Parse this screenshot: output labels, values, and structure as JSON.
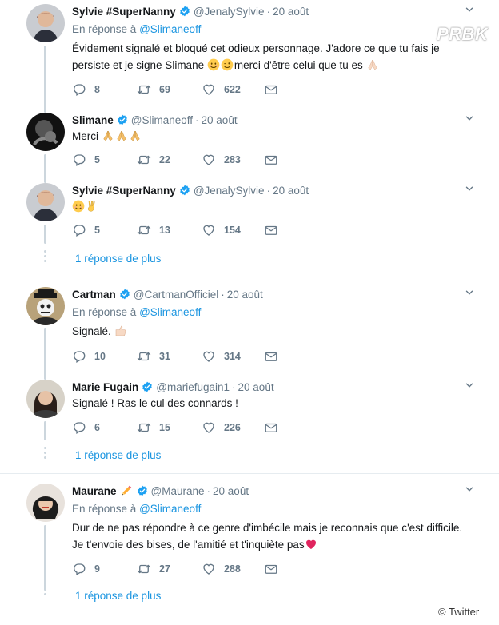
{
  "watermark": "PRBK",
  "credit": "© Twitter",
  "more_replies_label": "1 réponse de plus",
  "tweets": [
    {
      "name": "Sylvie #SuperNanny",
      "handle": "@JenalySylvie",
      "time": "20 août",
      "reply_prefix": "En réponse à",
      "reply_to": "@Slimaneoff",
      "text_line1": "Évidement signalé et bloqué cet odieux personnage. J'adore ce que  tu fais je",
      "text_line2": "persiste et je signe Slimane",
      "text_line2_end": "merci d'être celui que tu es",
      "replies": "8",
      "retweets": "69",
      "likes": "622"
    },
    {
      "name": "Slimane",
      "handle": "@Slimaneoff",
      "time": "20 août",
      "text": "Merci",
      "replies": "5",
      "retweets": "22",
      "likes": "283"
    },
    {
      "name": "Sylvie #SuperNanny",
      "handle": "@JenalySylvie",
      "time": "20 août",
      "replies": "5",
      "retweets": "13",
      "likes": "154"
    },
    {
      "name": "Cartman",
      "handle": "@CartmanOfficiel",
      "time": "20 août",
      "reply_prefix": "En réponse à",
      "reply_to": "@Slimaneoff",
      "text": "Signalé.",
      "replies": "10",
      "retweets": "31",
      "likes": "314"
    },
    {
      "name": "Marie Fugain",
      "handle": "@mariefugain1",
      "time": "20 août",
      "text": "Signalé ! Ras le cul des connards !",
      "replies": "6",
      "retweets": "15",
      "likes": "226"
    },
    {
      "name": "Maurane",
      "handle": "@Maurane",
      "time": "20 août",
      "reply_prefix": "En réponse à",
      "reply_to": "@Slimaneoff",
      "text_line1": "Dur de ne pas répondre à ce genre d'imbécile mais je reconnais que c'est difficile.",
      "text_line2": "Je t'envoie des bises, de l'amitié et t'inquiète pas",
      "replies": "9",
      "retweets": "27",
      "likes": "288"
    }
  ],
  "colors": {
    "link": "#1b95e0",
    "muted": "#657786",
    "divider": "#e6ecf0",
    "thread_line": "#ccd6dd",
    "verified": "#1da1f2",
    "heart_red": "#e0245e"
  }
}
